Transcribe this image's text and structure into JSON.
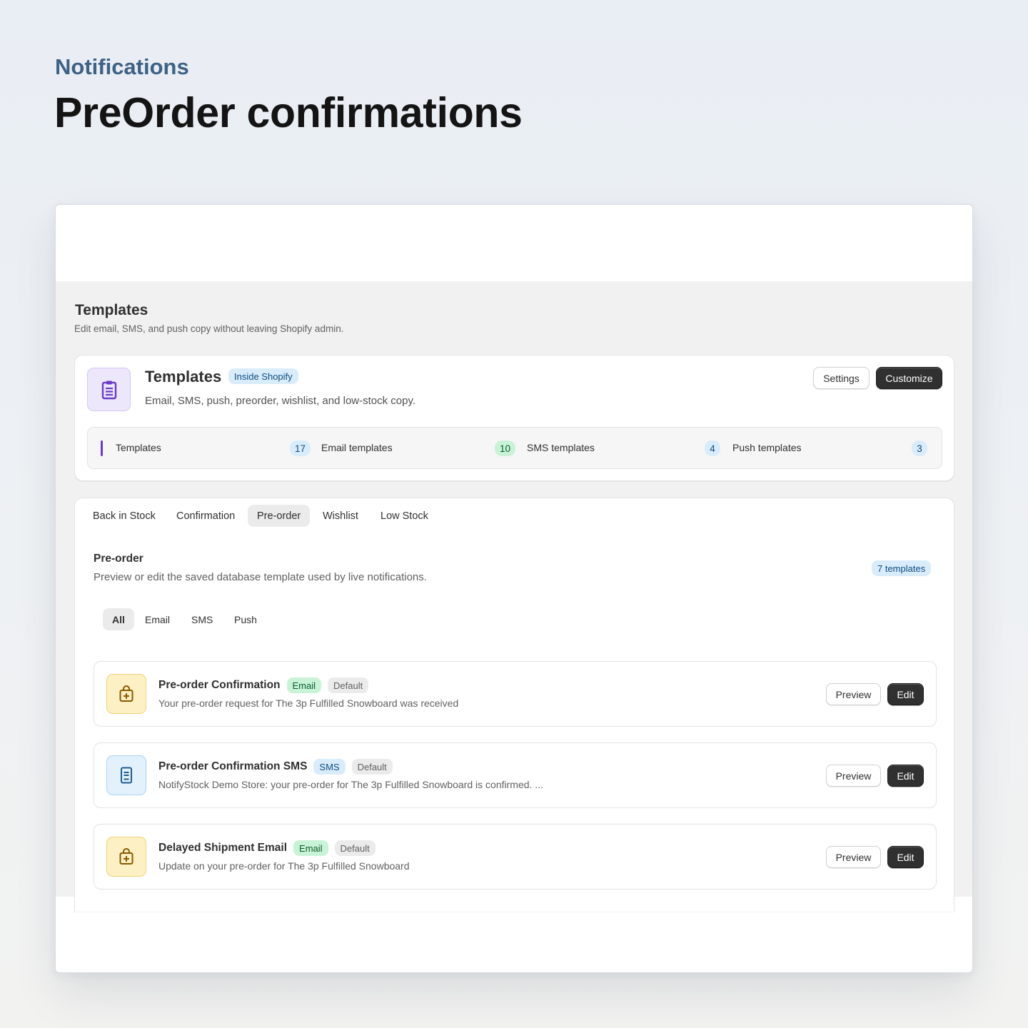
{
  "hero": {
    "eyebrow": "Notifications",
    "title": "PreOrder confirmations"
  },
  "page": {
    "title": "Templates",
    "subtitle": "Edit email, SMS, and push copy without leaving Shopify admin."
  },
  "summary_card": {
    "icon": "clipboard-icon",
    "title": "Templates",
    "badge": "Inside Shopify",
    "description": "Email, SMS, push, preorder, wishlist, and low-stock copy.",
    "settings_label": "Settings",
    "customize_label": "Customize",
    "stats": [
      {
        "label": "Templates",
        "count": "17"
      },
      {
        "label": "Email templates",
        "count": "10"
      },
      {
        "label": "SMS templates",
        "count": "4"
      },
      {
        "label": "Push templates",
        "count": "3"
      }
    ]
  },
  "tabs": [
    {
      "label": "Back in Stock"
    },
    {
      "label": "Confirmation"
    },
    {
      "label": "Pre-order",
      "active": true
    },
    {
      "label": "Wishlist"
    },
    {
      "label": "Low Stock"
    }
  ],
  "section": {
    "title": "Pre-order",
    "description": "Preview or edit the saved database template used by live notifications.",
    "count_badge": "7 templates"
  },
  "filters": [
    {
      "label": "All",
      "active": true
    },
    {
      "label": "Email"
    },
    {
      "label": "SMS"
    },
    {
      "label": "Push"
    }
  ],
  "templates": [
    {
      "icon": "shopping-bag-icon",
      "title": "Pre-order Confirmation",
      "channel": "Email",
      "tag": "Default",
      "description": "Your pre-order request for The 3p Fulfilled Snowboard was received",
      "preview_label": "Preview",
      "edit_label": "Edit"
    },
    {
      "icon": "mobile-message-icon",
      "title": "Pre-order Confirmation SMS",
      "channel": "SMS",
      "tag": "Default",
      "description": "NotifyStock Demo Store: your pre-order for The 3p Fulfilled Snowboard is confirmed. ...",
      "preview_label": "Preview",
      "edit_label": "Edit"
    },
    {
      "icon": "shopping-bag-icon",
      "title": "Delayed Shipment Email",
      "channel": "Email",
      "tag": "Default",
      "description": "Update on your pre-order for The 3p Fulfilled Snowboard",
      "preview_label": "Preview",
      "edit_label": "Edit"
    }
  ],
  "colors": {
    "accent_purple": "#6a3bc7",
    "eyebrow_blue": "#3e6286",
    "primary_button": "#303030",
    "email_badge": "#c9f3d7",
    "sms_badge": "#d9ecfb"
  }
}
